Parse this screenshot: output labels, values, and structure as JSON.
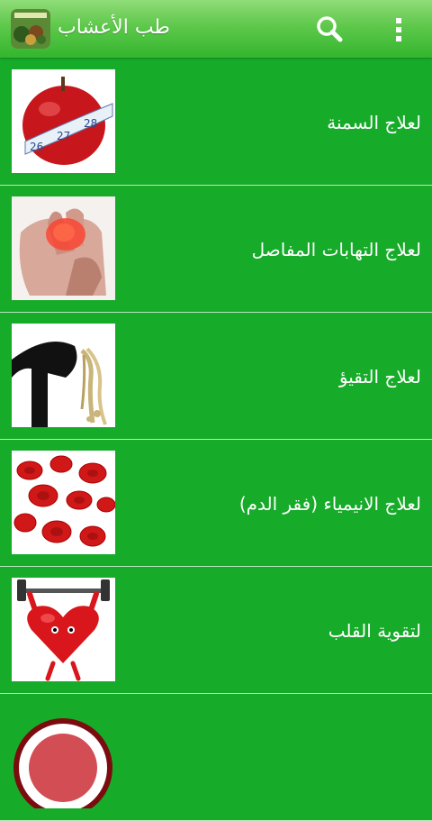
{
  "appbar": {
    "title": "طب الأعشاب",
    "icon": "herbs-app-icon",
    "search_icon": "search-icon",
    "menu_icon": "overflow-menu-icon"
  },
  "colors": {
    "background": "#17ab2a",
    "appbar": "#5ec84b",
    "text": "#ffffff"
  },
  "items": [
    {
      "label": "لعلاج السمنة",
      "image": "apple-measuring-tape"
    },
    {
      "label": "لعلاج التهابات المفاصل",
      "image": "painful-hand-joints"
    },
    {
      "label": "لعلاج التقيؤ",
      "image": "vomiting-figure"
    },
    {
      "label": "لعلاج الانيمياء (فقر الدم)",
      "image": "red-blood-cells"
    },
    {
      "label": "لتقوية القلب",
      "image": "heart-lifting-dumbbell"
    }
  ]
}
